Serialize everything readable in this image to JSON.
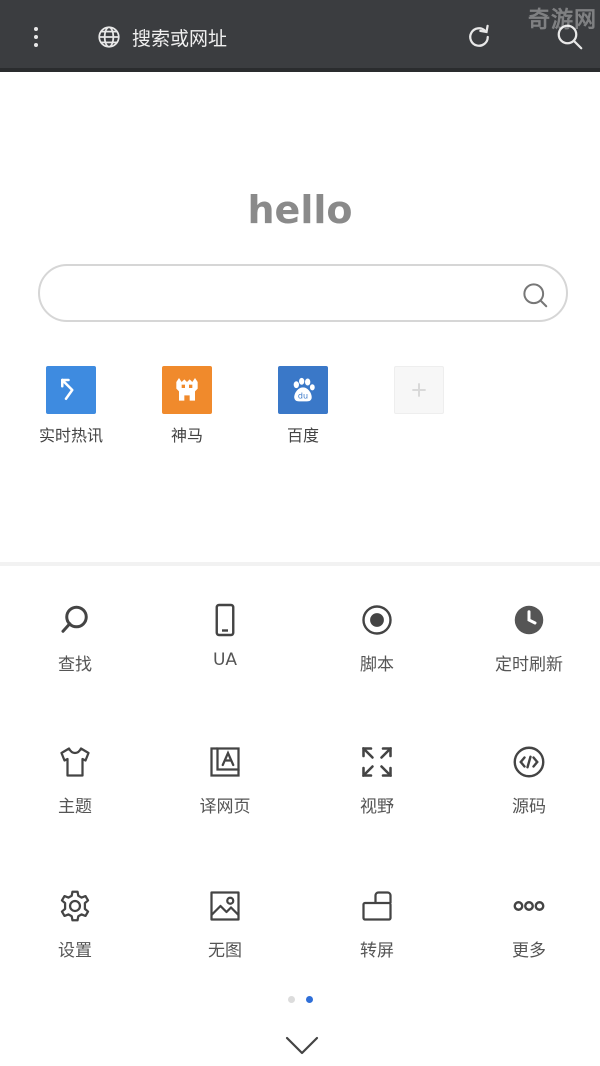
{
  "toolbar": {
    "url_placeholder": "搜索或网址",
    "watermark": "奇游网"
  },
  "home": {
    "greeting": "hello",
    "search_placeholder": ""
  },
  "shortcuts": [
    {
      "label": "实时热讯",
      "icon": "arrow-up-left-icon",
      "color": "#3e8be0"
    },
    {
      "label": "神马",
      "icon": "shenma-logo-icon",
      "color": "#f08a2c"
    },
    {
      "label": "百度",
      "icon": "baidu-paw-icon",
      "color": "#3a78c8"
    },
    {
      "label": "",
      "icon": "plus-icon",
      "color": "#f7f7f7"
    }
  ],
  "menu": [
    {
      "label": "查找",
      "icon": "find-icon"
    },
    {
      "label": "UA",
      "icon": "phone-icon"
    },
    {
      "label": "脚本",
      "icon": "record-icon"
    },
    {
      "label": "定时刷新",
      "icon": "clock-icon"
    },
    {
      "label": "主题",
      "icon": "tshirt-icon"
    },
    {
      "label": "译网页",
      "icon": "translate-icon"
    },
    {
      "label": "视野",
      "icon": "fullscreen-icon"
    },
    {
      "label": "源码",
      "icon": "code-icon"
    },
    {
      "label": "设置",
      "icon": "gear-icon"
    },
    {
      "label": "无图",
      "icon": "image-icon"
    },
    {
      "label": "转屏",
      "icon": "rotate-screen-icon"
    },
    {
      "label": "更多",
      "icon": "more-dots-icon"
    }
  ],
  "pager": {
    "pages": 2,
    "active": 2
  },
  "colors": {
    "toolbar_bg": "#3b3d40",
    "accent": "#2f6fd8"
  }
}
